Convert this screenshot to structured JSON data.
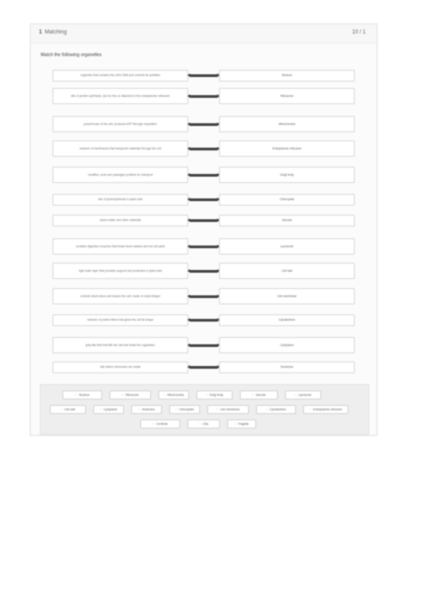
{
  "header": {
    "question_number": "1",
    "question_label": "Matching",
    "points": "10 / 1"
  },
  "prompt": "Match the following organelles",
  "pairs": [
    {
      "left": "organelle that contains the cell's DNA and controls its activities",
      "right": "Nucleus"
    },
    {
      "left": "site of protein synthesis; can be free or attached to the endoplasmic reticulum",
      "right": "Ribosome"
    },
    {
      "left": "powerhouse of the cell; produces ATP through respiration",
      "right": "Mitochondria"
    },
    {
      "left": "network of membranes that transports materials through the cell",
      "right": "Endoplasmic reticulum"
    },
    {
      "left": "modifies, sorts and packages proteins for transport",
      "right": "Golgi body"
    },
    {
      "left": "site of photosynthesis in plant cells",
      "right": "Chloroplast"
    },
    {
      "left": "stores water and other materials",
      "right": "Vacuole"
    },
    {
      "left": "contains digestive enzymes that break down wastes and old cell parts",
      "right": "Lysosome"
    },
    {
      "left": "rigid outer layer that provides support and protection in plant cells",
      "right": "Cell wall"
    },
    {
      "left": "controls what enters and leaves the cell; made of a lipid bilayer",
      "right": "Cell membrane"
    },
    {
      "left": "network of protein fibers that gives the cell its shape",
      "right": "Cytoskeleton"
    },
    {
      "left": "jelly-like fluid that fills the cell and holds the organelles",
      "right": "Cytoplasm"
    },
    {
      "left": "site where ribosomes are made",
      "right": "Nucleolus"
    }
  ],
  "bank": {
    "label": "Answer bank",
    "chips": [
      [
        "Nucleus",
        "Ribosome",
        "Mitochondria",
        "Golgi body",
        "Vacuole",
        "Lysosome"
      ],
      [
        "Cell wall",
        "Cytoplasm",
        "Nucleolus",
        "Chloroplast",
        "Cell membrane",
        "Cytoskeleton",
        "Endoplasmic reticulum"
      ],
      [
        "Centriole",
        "Cilia",
        "Flagella"
      ]
    ]
  }
}
